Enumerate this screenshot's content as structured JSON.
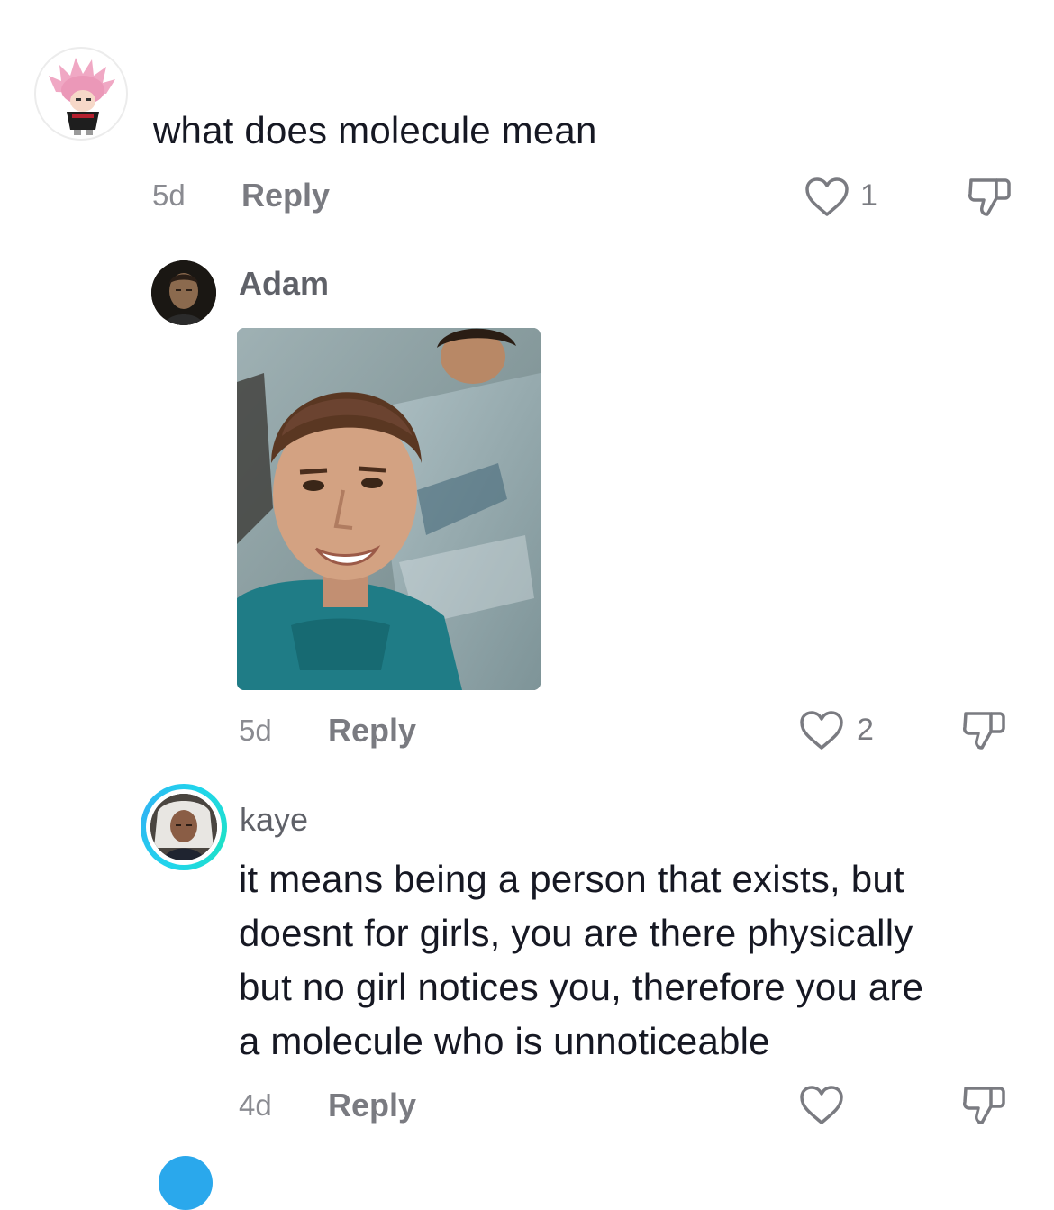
{
  "comments": [
    {
      "text": "what does molecule mean",
      "time": "5d",
      "reply_label": "Reply",
      "likes": "1"
    },
    {
      "username": "Adam",
      "time": "5d",
      "reply_label": "Reply",
      "likes": "2"
    },
    {
      "username": "kaye",
      "text_lines": [
        "it means being a person that exists, but",
        "doesnt for girls, you are there physically",
        "but no girl notices you, therefore you are",
        "a molecule who is unnoticeable"
      ],
      "time": "4d",
      "reply_label": "Reply",
      "likes": ""
    }
  ],
  "icons": {
    "like": "heart-outline-icon",
    "dislike": "thumbs-down-icon"
  },
  "colors": {
    "text": "#161823",
    "secondary": "#7a7b81",
    "ring": "#20d5ec"
  }
}
